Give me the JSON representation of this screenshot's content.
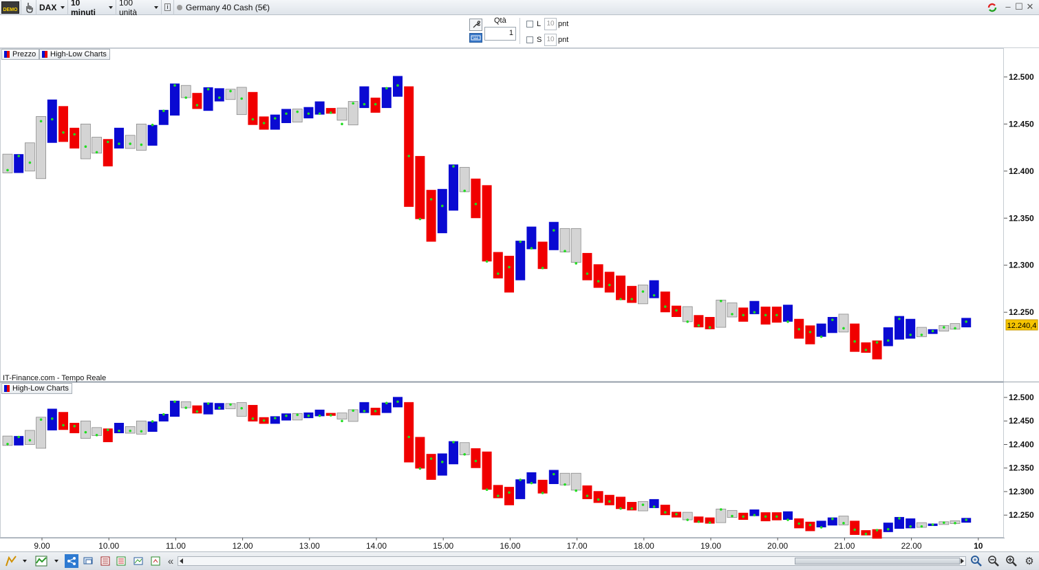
{
  "toolbar": {
    "demo_badge": "DEMO",
    "instrument": "DAX",
    "timeframe": "10 minuti",
    "units": "100 unità",
    "info": "i",
    "instrument_name": "Germany 40 Cash (5€)"
  },
  "order": {
    "qty_label": "Qtà",
    "qty_value": "1",
    "long_label": "L",
    "short_label": "S",
    "long_pnt": "10",
    "short_pnt": "10",
    "pnt_unit": "pnt"
  },
  "legend": {
    "price_tab": "Prezzo",
    "hl_tab": "High-Low Charts",
    "lower_tab": "High-Low Charts"
  },
  "source": "IT-Finance.com - Tempo Reale",
  "chart_data": {
    "type": "candlestick",
    "time_labels": [
      "9.00",
      "10.00",
      "11.00",
      "12.00",
      "13.00",
      "14.00",
      "15.00",
      "16.00",
      "17.00",
      "18.00",
      "19.00",
      "20.00",
      "21.00",
      "22.00",
      "10"
    ],
    "upper_yticks": [
      "12.500",
      "12.450",
      "12.400",
      "12.350",
      "12.300",
      "12.250"
    ],
    "lower_yticks": [
      "12.500",
      "12.450",
      "12.400",
      "12.350",
      "12.300",
      "12.250"
    ],
    "upper_ylim": [
      12180,
      12516
    ],
    "lower_ylim": [
      12205,
      12519
    ],
    "last_price": "12.240,4",
    "colors": {
      "up": "#0a0ad2",
      "down": "#f00000",
      "neutral": "#d4d4d4",
      "marker": "#22dd22",
      "last_price_bg": "#f5c400"
    },
    "bars": [
      {
        "o": 12398,
        "c": 12418,
        "m": 12401
      },
      {
        "o": 12398,
        "c": 12418,
        "m": 12416
      },
      {
        "o": 12400,
        "c": 12430,
        "m": 12409
      },
      {
        "o": 12392,
        "c": 12458,
        "m": 12453
      },
      {
        "o": 12430,
        "c": 12476,
        "m": 12455
      },
      {
        "o": 12469,
        "c": 12431,
        "m": 12441
      },
      {
        "o": 12446,
        "c": 12424,
        "m": 12439
      },
      {
        "o": 12413,
        "c": 12450,
        "m": 12426
      },
      {
        "o": 12419,
        "c": 12436,
        "m": 12420
      },
      {
        "o": 12434,
        "c": 12405,
        "m": 12431
      },
      {
        "o": 12424,
        "c": 12446,
        "m": 12429
      },
      {
        "o": 12424,
        "c": 12438,
        "m": 12429
      },
      {
        "o": 12422,
        "c": 12450,
        "m": 12428
      },
      {
        "o": 12427,
        "c": 12449,
        "m": 12449
      },
      {
        "o": 12449,
        "c": 12465,
        "m": 12464
      },
      {
        "o": 12459,
        "c": 12493,
        "m": 12491
      },
      {
        "o": 12478,
        "c": 12491,
        "m": 12478
      },
      {
        "o": 12483,
        "c": 12466,
        "m": 12470
      },
      {
        "o": 12464,
        "c": 12489,
        "m": 12487
      },
      {
        "o": 12474,
        "c": 12488,
        "m": 12478
      },
      {
        "o": 12476,
        "c": 12487,
        "m": 12485
      },
      {
        "o": 12460,
        "c": 12489,
        "m": 12477
      },
      {
        "o": 12484,
        "c": 12449,
        "m": 12455
      },
      {
        "o": 12458,
        "c": 12444,
        "m": 12451
      },
      {
        "o": 12444,
        "c": 12460,
        "m": 12456
      },
      {
        "o": 12451,
        "c": 12466,
        "m": 12461
      },
      {
        "o": 12452,
        "c": 12466,
        "m": 12463
      },
      {
        "o": 12456,
        "c": 12468,
        "m": 12461
      },
      {
        "o": 12460,
        "c": 12474,
        "m": 12461
      },
      {
        "o": 12467,
        "c": 12461,
        "m": 12462
      },
      {
        "o": 12454,
        "c": 12467,
        "m": 12450
      },
      {
        "o": 12449,
        "c": 12474,
        "m": 12472
      },
      {
        "o": 12467,
        "c": 12490,
        "m": 12471
      },
      {
        "o": 12478,
        "c": 12462,
        "m": 12471
      },
      {
        "o": 12467,
        "c": 12489,
        "m": 12488
      },
      {
        "o": 12479,
        "c": 12501,
        "m": 12491
      },
      {
        "o": 12490,
        "c": 12362,
        "m": 12416
      },
      {
        "o": 12416,
        "c": 12349,
        "m": 12349
      },
      {
        "o": 12380,
        "c": 12325,
        "m": 12370
      },
      {
        "o": 12334,
        "c": 12381,
        "m": 12363
      },
      {
        "o": 12358,
        "c": 12407,
        "m": 12405
      },
      {
        "o": 12378,
        "c": 12404,
        "m": 12379
      },
      {
        "o": 12392,
        "c": 12350,
        "m": 12365
      },
      {
        "o": 12385,
        "c": 12304,
        "m": 12304
      },
      {
        "o": 12314,
        "c": 12286,
        "m": 12291
      },
      {
        "o": 12310,
        "c": 12271,
        "m": 12298
      },
      {
        "o": 12284,
        "c": 12326,
        "m": 12325
      },
      {
        "o": 12317,
        "c": 12341,
        "m": 12318
      },
      {
        "o": 12325,
        "c": 12296,
        "m": 12297
      },
      {
        "o": 12316,
        "c": 12346,
        "m": 12337
      },
      {
        "o": 12314,
        "c": 12339,
        "m": 12315
      },
      {
        "o": 12303,
        "c": 12339,
        "m": 12302
      },
      {
        "o": 12313,
        "c": 12284,
        "m": 12291
      },
      {
        "o": 12301,
        "c": 12276,
        "m": 12283
      },
      {
        "o": 12293,
        "c": 12271,
        "m": 12279
      },
      {
        "o": 12289,
        "c": 12263,
        "m": 12264
      },
      {
        "o": 12278,
        "c": 12260,
        "m": 12264
      },
      {
        "o": 12259,
        "c": 12279,
        "m": 12272
      },
      {
        "o": 12265,
        "c": 12284,
        "m": 12268
      },
      {
        "o": 12272,
        "c": 12250,
        "m": 12256
      },
      {
        "o": 12257,
        "c": 12245,
        "m": 12252
      },
      {
        "o": 12240,
        "c": 12256,
        "m": 12240
      },
      {
        "o": 12247,
        "c": 12234,
        "m": 12236
      },
      {
        "o": 12245,
        "c": 12232,
        "m": 12234
      },
      {
        "o": 12234,
        "c": 12263,
        "m": 12262
      },
      {
        "o": 12245,
        "c": 12260,
        "m": 12248
      },
      {
        "o": 12255,
        "c": 12240,
        "m": 12247
      },
      {
        "o": 12248,
        "c": 12262,
        "m": 12250
      },
      {
        "o": 12256,
        "c": 12237,
        "m": 12247
      },
      {
        "o": 12256,
        "c": 12239,
        "m": 12247
      },
      {
        "o": 12240,
        "c": 12258,
        "m": 12240
      },
      {
        "o": 12243,
        "c": 12222,
        "m": 12232
      },
      {
        "o": 12236,
        "c": 12216,
        "m": 12229
      },
      {
        "o": 12224,
        "c": 12238,
        "m": 12224
      },
      {
        "o": 12228,
        "c": 12245,
        "m": 12242
      },
      {
        "o": 12229,
        "c": 12248,
        "m": 12233
      },
      {
        "o": 12238,
        "c": 12208,
        "m": 12219
      },
      {
        "o": 12218,
        "c": 12207,
        "m": 12210
      },
      {
        "o": 12220,
        "c": 12200,
        "m": 12218
      },
      {
        "o": 12214,
        "c": 12234,
        "m": 12220
      },
      {
        "o": 12221,
        "c": 12246,
        "m": 12243
      },
      {
        "o": 12222,
        "c": 12243,
        "m": 12226
      },
      {
        "o": 12234,
        "c": 12224,
        "m": 12226
      },
      {
        "o": 12227,
        "c": 12232,
        "m": 12230
      },
      {
        "o": 12230,
        "c": 12236,
        "m": 12234
      },
      {
        "o": 12232,
        "c": 12238,
        "m": 12233
      },
      {
        "o": 12234,
        "c": 12244,
        "m": 12240
      }
    ]
  }
}
